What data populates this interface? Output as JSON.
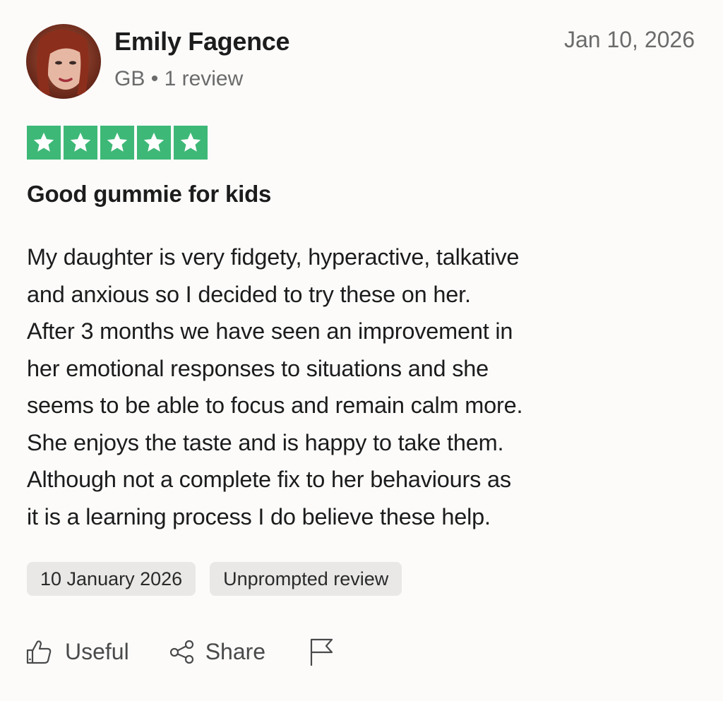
{
  "reviewer": {
    "name": "Emily Fagence",
    "country": "GB",
    "separator": "•",
    "review_count": "1 review"
  },
  "review": {
    "date": "Jan 10, 2026",
    "rating": 5,
    "rating_max": 5,
    "star_color": "#3eb877",
    "title": "Good gummie for kids",
    "body_lines": [
      "My daughter is very fidgety, hyperactive, talkative",
      "and anxious so I decided to try these on her.",
      "After 3 months we have seen an improvement in",
      "her emotional responses to situations and she",
      "seems to be able to focus and remain calm more.",
      "She enjoys the taste and is happy to take them.",
      "Although not a complete fix to her behaviours as",
      "it is a learning process I do believe these help."
    ]
  },
  "badges": {
    "experience_date": "10 January 2026",
    "review_type": "Unprompted review"
  },
  "actions": {
    "useful_label": "Useful",
    "useful_icon": "thumbs-up-icon",
    "share_label": "Share",
    "share_icon": "share-icon",
    "report_icon": "flag-icon"
  }
}
